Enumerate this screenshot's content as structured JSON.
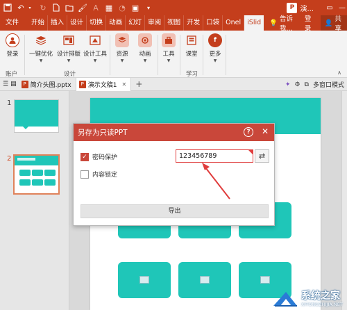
{
  "titlebar": {
    "doc_title": "演...",
    "ppt_badge": "P",
    "quick_icons": [
      "save-icon",
      "undo-icon",
      "redo-icon",
      "new-icon",
      "open-icon",
      "print-icon"
    ]
  },
  "tabs": {
    "file": "文件",
    "items": [
      "开始",
      "插入",
      "设计",
      "切换",
      "动画",
      "幻灯",
      "审阅",
      "视图",
      "开发",
      "口袋",
      "Onel",
      "iSlid"
    ],
    "tell_me": "告诉我...",
    "login": "登录",
    "share": "共享"
  },
  "ribbon": {
    "login": "登录",
    "one_click": "一键优化",
    "design_layout": "设计排版",
    "design_tools": "设计工具",
    "resources": "资源",
    "animation": "动画",
    "tools": "工具",
    "classroom": "课堂",
    "more": "更多",
    "group_account": "账户",
    "group_design": "设计",
    "group_learn": "学习"
  },
  "doctabs": {
    "tab1": "简介头图.pptx",
    "tab2": "演示文稿1",
    "multi_window": "多窗口模式"
  },
  "thumbs": {
    "n1": "1",
    "n2": "2"
  },
  "dialog": {
    "title": "另存为只读PPT",
    "help": "?",
    "close": "✕",
    "password_protect": "密码保护",
    "password_value": "123456789",
    "content_lock": "内容锁定",
    "export": "导出"
  },
  "watermark": {
    "cn": "系统之家",
    "en": "XITONGZHIJIA.NET"
  },
  "colors": {
    "accent": "#c43e1c",
    "dialog_header": "#c9473a",
    "teal": "#1fc6b8",
    "arrow": "#e03c3c"
  }
}
